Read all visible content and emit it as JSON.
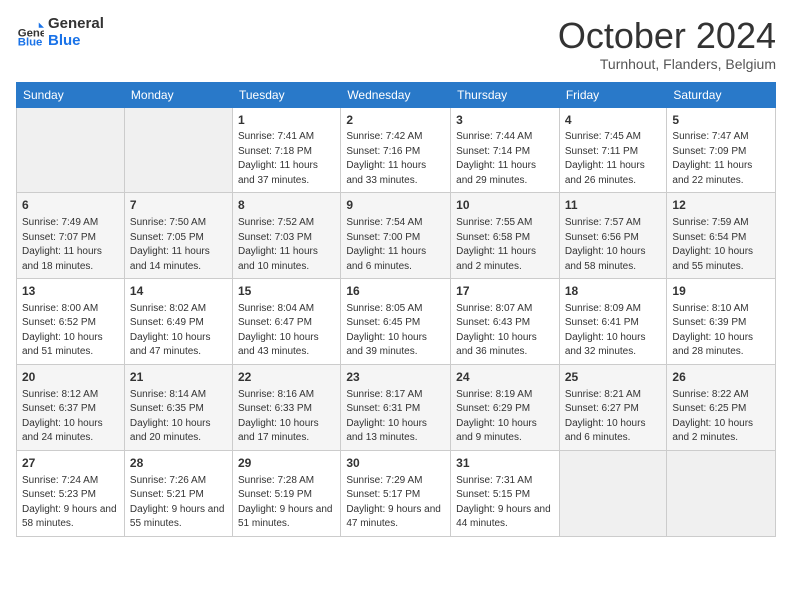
{
  "logo": {
    "line1": "General",
    "line2": "Blue"
  },
  "title": "October 2024",
  "location": "Turnhout, Flanders, Belgium",
  "days_header": [
    "Sunday",
    "Monday",
    "Tuesday",
    "Wednesday",
    "Thursday",
    "Friday",
    "Saturday"
  ],
  "weeks": [
    [
      {
        "day": "",
        "empty": true
      },
      {
        "day": "",
        "empty": true
      },
      {
        "day": "1",
        "sunrise": "7:41 AM",
        "sunset": "7:18 PM",
        "daylight": "11 hours and 37 minutes."
      },
      {
        "day": "2",
        "sunrise": "7:42 AM",
        "sunset": "7:16 PM",
        "daylight": "11 hours and 33 minutes."
      },
      {
        "day": "3",
        "sunrise": "7:44 AM",
        "sunset": "7:14 PM",
        "daylight": "11 hours and 29 minutes."
      },
      {
        "day": "4",
        "sunrise": "7:45 AM",
        "sunset": "7:11 PM",
        "daylight": "11 hours and 26 minutes."
      },
      {
        "day": "5",
        "sunrise": "7:47 AM",
        "sunset": "7:09 PM",
        "daylight": "11 hours and 22 minutes."
      }
    ],
    [
      {
        "day": "6",
        "sunrise": "7:49 AM",
        "sunset": "7:07 PM",
        "daylight": "11 hours and 18 minutes."
      },
      {
        "day": "7",
        "sunrise": "7:50 AM",
        "sunset": "7:05 PM",
        "daylight": "11 hours and 14 minutes."
      },
      {
        "day": "8",
        "sunrise": "7:52 AM",
        "sunset": "7:03 PM",
        "daylight": "11 hours and 10 minutes."
      },
      {
        "day": "9",
        "sunrise": "7:54 AM",
        "sunset": "7:00 PM",
        "daylight": "11 hours and 6 minutes."
      },
      {
        "day": "10",
        "sunrise": "7:55 AM",
        "sunset": "6:58 PM",
        "daylight": "11 hours and 2 minutes."
      },
      {
        "day": "11",
        "sunrise": "7:57 AM",
        "sunset": "6:56 PM",
        "daylight": "10 hours and 58 minutes."
      },
      {
        "day": "12",
        "sunrise": "7:59 AM",
        "sunset": "6:54 PM",
        "daylight": "10 hours and 55 minutes."
      }
    ],
    [
      {
        "day": "13",
        "sunrise": "8:00 AM",
        "sunset": "6:52 PM",
        "daylight": "10 hours and 51 minutes."
      },
      {
        "day": "14",
        "sunrise": "8:02 AM",
        "sunset": "6:49 PM",
        "daylight": "10 hours and 47 minutes."
      },
      {
        "day": "15",
        "sunrise": "8:04 AM",
        "sunset": "6:47 PM",
        "daylight": "10 hours and 43 minutes."
      },
      {
        "day": "16",
        "sunrise": "8:05 AM",
        "sunset": "6:45 PM",
        "daylight": "10 hours and 39 minutes."
      },
      {
        "day": "17",
        "sunrise": "8:07 AM",
        "sunset": "6:43 PM",
        "daylight": "10 hours and 36 minutes."
      },
      {
        "day": "18",
        "sunrise": "8:09 AM",
        "sunset": "6:41 PM",
        "daylight": "10 hours and 32 minutes."
      },
      {
        "day": "19",
        "sunrise": "8:10 AM",
        "sunset": "6:39 PM",
        "daylight": "10 hours and 28 minutes."
      }
    ],
    [
      {
        "day": "20",
        "sunrise": "8:12 AM",
        "sunset": "6:37 PM",
        "daylight": "10 hours and 24 minutes."
      },
      {
        "day": "21",
        "sunrise": "8:14 AM",
        "sunset": "6:35 PM",
        "daylight": "10 hours and 20 minutes."
      },
      {
        "day": "22",
        "sunrise": "8:16 AM",
        "sunset": "6:33 PM",
        "daylight": "10 hours and 17 minutes."
      },
      {
        "day": "23",
        "sunrise": "8:17 AM",
        "sunset": "6:31 PM",
        "daylight": "10 hours and 13 minutes."
      },
      {
        "day": "24",
        "sunrise": "8:19 AM",
        "sunset": "6:29 PM",
        "daylight": "10 hours and 9 minutes."
      },
      {
        "day": "25",
        "sunrise": "8:21 AM",
        "sunset": "6:27 PM",
        "daylight": "10 hours and 6 minutes."
      },
      {
        "day": "26",
        "sunrise": "8:22 AM",
        "sunset": "6:25 PM",
        "daylight": "10 hours and 2 minutes."
      }
    ],
    [
      {
        "day": "27",
        "sunrise": "7:24 AM",
        "sunset": "5:23 PM",
        "daylight": "9 hours and 58 minutes."
      },
      {
        "day": "28",
        "sunrise": "7:26 AM",
        "sunset": "5:21 PM",
        "daylight": "9 hours and 55 minutes."
      },
      {
        "day": "29",
        "sunrise": "7:28 AM",
        "sunset": "5:19 PM",
        "daylight": "9 hours and 51 minutes."
      },
      {
        "day": "30",
        "sunrise": "7:29 AM",
        "sunset": "5:17 PM",
        "daylight": "9 hours and 47 minutes."
      },
      {
        "day": "31",
        "sunrise": "7:31 AM",
        "sunset": "5:15 PM",
        "daylight": "9 hours and 44 minutes."
      },
      {
        "day": "",
        "empty": true
      },
      {
        "day": "",
        "empty": true
      }
    ]
  ],
  "labels": {
    "sunrise": "Sunrise:",
    "sunset": "Sunset:",
    "daylight": "Daylight:"
  }
}
